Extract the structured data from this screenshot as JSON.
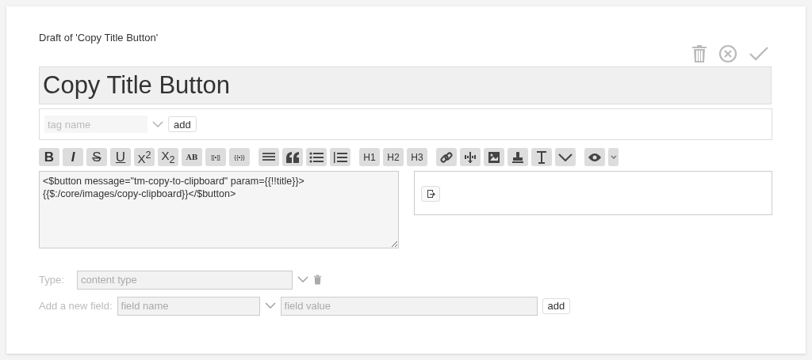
{
  "draft_label": "Draft of 'Copy Title Button'",
  "title_field": {
    "value": "Copy Title Button"
  },
  "tags": {
    "placeholder": "tag name",
    "add_button": "add"
  },
  "toolbar": [
    [
      {
        "kind": "bold",
        "label": "B"
      },
      {
        "kind": "italic",
        "label": "I"
      },
      {
        "kind": "strike",
        "label": "S"
      },
      {
        "kind": "underline",
        "label": "U"
      },
      {
        "kind": "plain",
        "label": "X$^{2}$"
      },
      {
        "kind": "plain",
        "label": "X$_{2}$"
      },
      {
        "kind": "small",
        "label": "AB"
      },
      {
        "kind": "tiny",
        "label": "[[•]]"
      },
      {
        "kind": "tiny",
        "label": "{{•}}"
      }
    ],
    [
      {
        "kind": "icon"
      },
      {
        "kind": "icon"
      },
      {
        "kind": "icon"
      },
      {
        "kind": "icon"
      }
    ],
    [
      {
        "kind": "heading",
        "label": "H1"
      },
      {
        "kind": "heading",
        "label": "H2"
      },
      {
        "kind": "heading",
        "label": "H3"
      }
    ],
    [
      {
        "kind": "icon"
      },
      {
        "kind": "icon"
      },
      {
        "kind": "icon"
      },
      {
        "kind": "icon"
      },
      {
        "kind": "icon"
      },
      {
        "kind": "icon"
      }
    ],
    [
      {
        "kind": "icon"
      },
      {
        "kind": "icon"
      }
    ]
  ],
  "editor": {
    "text": "<$button message=\"tm-copy-to-clipboard\" param={{!!title}}>\n{{$:/core/images/copy-clipboard}}</$button>"
  },
  "type_row": {
    "label": "Type:",
    "placeholder": "content type"
  },
  "field_row": {
    "label": "Add a new field:",
    "name_placeholder": "field name",
    "value_placeholder": "field value",
    "add_button": "add"
  }
}
